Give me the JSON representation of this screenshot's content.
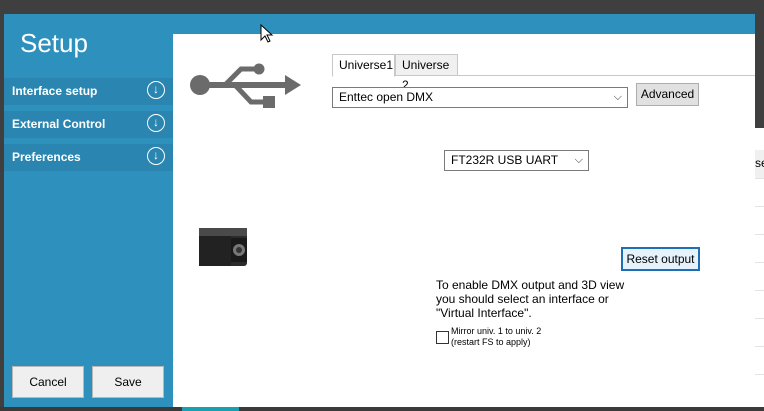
{
  "sidebar": {
    "title": "Setup",
    "items": [
      {
        "label": "Interface setup"
      },
      {
        "label": "External Control"
      },
      {
        "label": "Preferences"
      }
    ],
    "cancel_label": "Cancel",
    "save_label": "Save"
  },
  "tabs": [
    {
      "label": "Universe1",
      "active": true
    },
    {
      "label": "Universe 2",
      "active": false
    }
  ],
  "interface": {
    "selected": "Enttec open DMX",
    "advanced_label": "Advanced",
    "device_selected": "FT232R USB UART",
    "reset_label": "Reset output",
    "hint_lines": [
      "To enable DMX output and 3D view",
      "you should select an interface or",
      "\"Virtual Interface\"."
    ],
    "mirror_lines": [
      "Mirror univ. 1 to univ. 2",
      "(restart FS to apply)"
    ],
    "mirror_checked": false
  },
  "background_window": {
    "header_fragment": "se"
  },
  "colors": {
    "accent": "#2e91bd",
    "focus": "#1f6fb5"
  },
  "icons": [
    "usb-icon",
    "chevron-down-icon",
    "arrow-down-circle-icon",
    "dmx-interface-device",
    "mouse-cursor-icon"
  ]
}
